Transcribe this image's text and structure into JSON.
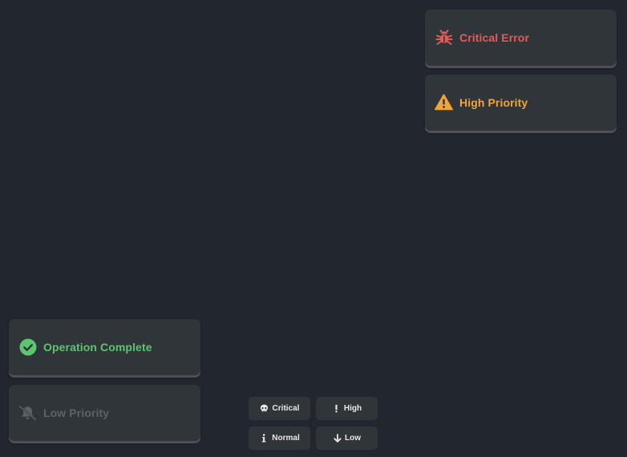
{
  "notifications": {
    "critical": {
      "title": "Critical Error",
      "icon": "bug-icon",
      "color": "#e05c58"
    },
    "high": {
      "title": "High Priority",
      "icon": "warning-triangle-icon",
      "color": "#f2a33a"
    },
    "success": {
      "title": "Operation Complete",
      "icon": "check-circle-icon",
      "color": "#5bc66f"
    },
    "low": {
      "title": "Low Priority",
      "icon": "bell-slash-icon",
      "color": "#5d6268"
    }
  },
  "triggers": {
    "critical": {
      "label": "Critical",
      "icon": "skull-icon"
    },
    "high": {
      "label": "High",
      "icon": "exclamation-icon"
    },
    "normal": {
      "label": "Normal",
      "icon": "info-icon"
    },
    "low": {
      "label": "Low",
      "icon": "arrow-down-icon"
    }
  },
  "colors": {
    "background": "#22262e",
    "surface": "#30353a",
    "text": "#e6e8ea"
  }
}
